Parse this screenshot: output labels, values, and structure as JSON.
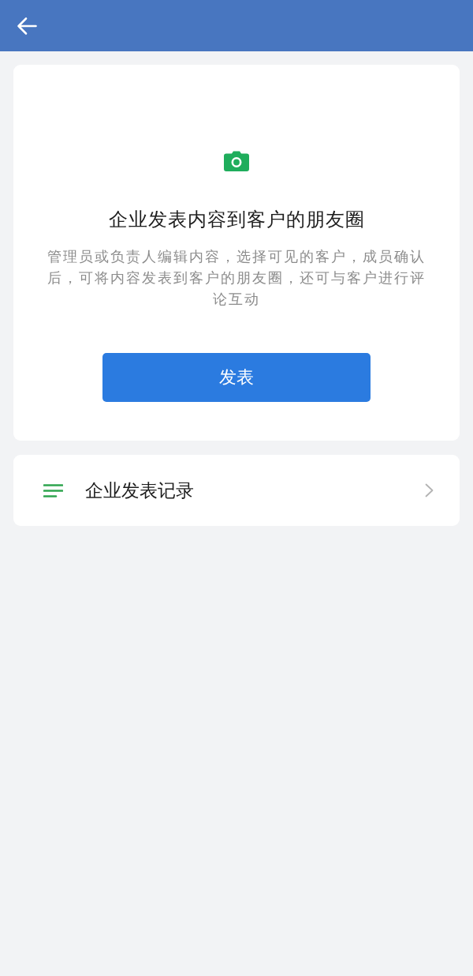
{
  "intro": {
    "title": "企业发表内容到客户的朋友圈",
    "description": "管理员或负责人编辑内容，选择可见的客户，成员确认后，可将内容发表到客户的朋友圈，还可与客户进行评论互动",
    "button": "发表"
  },
  "menu": [
    {
      "label": "企业发表记录"
    }
  ]
}
